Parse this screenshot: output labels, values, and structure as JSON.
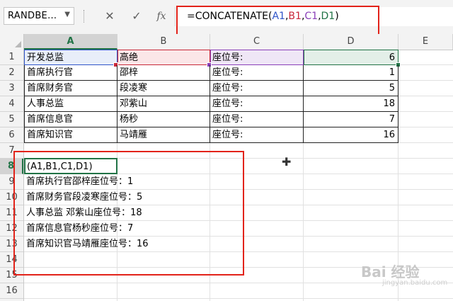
{
  "formula_bar": {
    "name_box": "RANDBE...",
    "cancel_icon": "✕",
    "enter_icon": "✓",
    "fx_icon": "fx",
    "formula_prefix": "=CONCATENATE(",
    "ref_a": "A1",
    "comma1": ",",
    "ref_b": "B1",
    "comma2": ",",
    "ref_c": "C1",
    "comma3": ",",
    "ref_d": "D1",
    "formula_suffix": ")"
  },
  "columns": [
    "A",
    "B",
    "C",
    "D",
    "E"
  ],
  "rows": [
    "1",
    "2",
    "3",
    "4",
    "5",
    "6",
    "7",
    "8",
    "9",
    "10",
    "11",
    "12",
    "13",
    "14",
    "15",
    "16"
  ],
  "table": [
    [
      "开发总监",
      "高绝",
      "座位号:",
      "6"
    ],
    [
      "首席执行官",
      "邵梓",
      "座位号:",
      "1"
    ],
    [
      "首席财务官",
      "段凌寒",
      "座位号:",
      "5"
    ],
    [
      "人事总监",
      "邓紫山",
      "座位号:",
      "18"
    ],
    [
      "首席信息官",
      "杨秒",
      "座位号:",
      "7"
    ],
    [
      "首席知识官",
      "马靖雁",
      "座位号:",
      "16"
    ]
  ],
  "editing_cell": "(A1,B1,C1,D1)",
  "results": [
    "首席执行官邵梓座位号：1",
    "首席财务官段凌寒座位号：5",
    "人事总监 邓紫山座位号：18",
    "首席信息官杨秒座位号：7",
    "首席知识官马靖雁座位号：16"
  ],
  "colors": {
    "excel_green": "#217346",
    "ref_a": "#2f55c8",
    "ref_b": "#c8283a",
    "ref_c": "#8a3fb8",
    "highlight_red": "#e2231a"
  },
  "watermark": {
    "main": "Bai 经验",
    "sub": "jingyan.baidu.com"
  }
}
